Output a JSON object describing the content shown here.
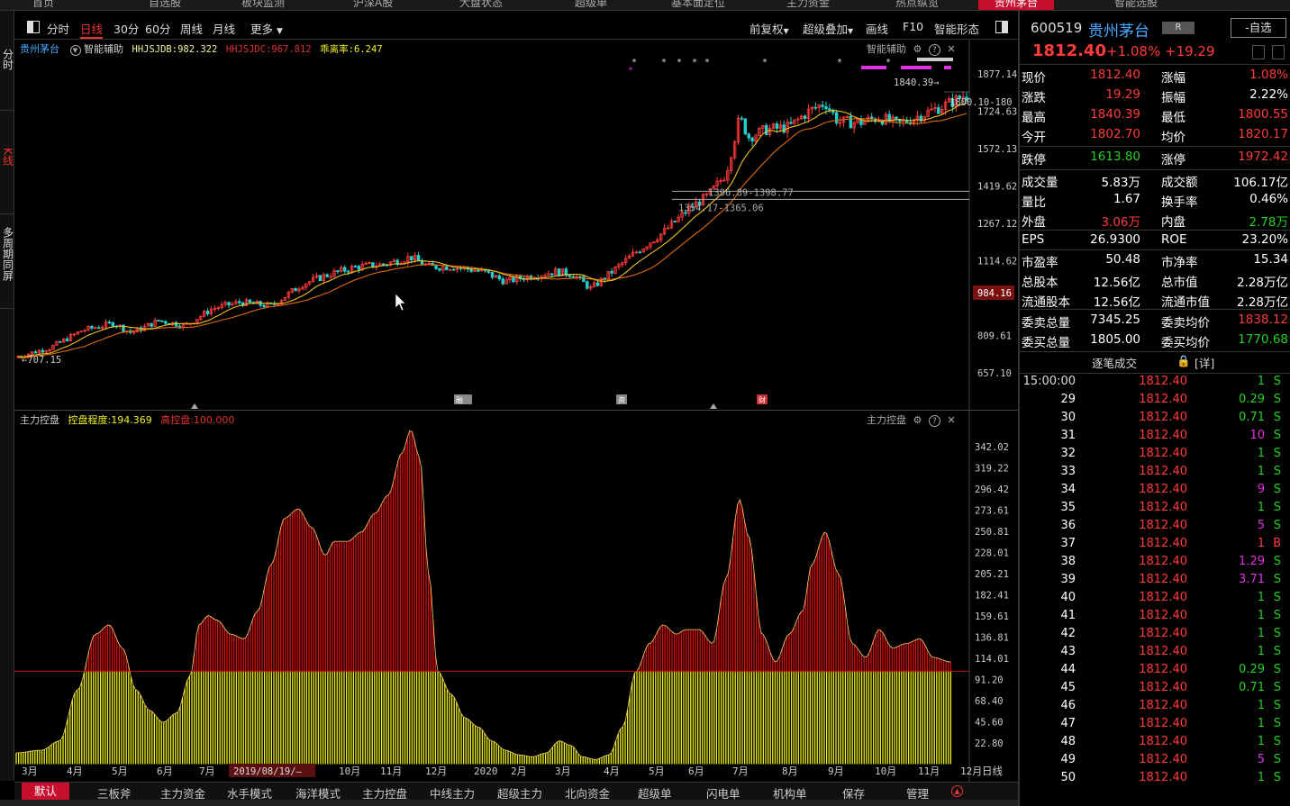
{
  "topnav": [
    {
      "label": "首页"
    },
    {
      "label": "自选股"
    },
    {
      "label": "板块监测"
    },
    {
      "label": "沪深A股"
    },
    {
      "label": "大盘状态"
    },
    {
      "label": "超级单"
    },
    {
      "label": "基本面定位"
    },
    {
      "label": "主力资金"
    },
    {
      "label": "热点纵览"
    },
    {
      "label": "贵州茅台"
    },
    {
      "label": "智能选股"
    }
  ],
  "leftbar": {
    "fenshi": "分时",
    "kxian": "K线",
    "multi": "多周期同屏"
  },
  "toolbar": {
    "left": [
      "分时",
      "日线",
      "30分",
      "60分",
      "周线",
      "月线",
      "更多"
    ],
    "right": [
      "前复权",
      "超级叠加",
      "画线",
      "F10",
      "智能形态"
    ]
  },
  "kchart": {
    "stock_name": "贵州茅台",
    "assist_label": "智能辅助",
    "ind1": "HHJSJDB:982.322",
    "ind2": "HHJSJDC:967.812",
    "ind3": "乖离率:6.247",
    "assist_right": "智能辅助",
    "y_ticks": [
      "1877.14",
      "1724.63",
      "1572.13",
      "1419.62",
      "1267.12",
      "1114.62",
      "984.16",
      "809.61",
      "657.10"
    ],
    "current_price_tag": "984.16",
    "annot_high": "1840.39",
    "annot_right": "1800.10-180",
    "annot_level1": "1396.89-1398.77",
    "annot_level2": "1354.17-1365.06",
    "annot_low": "707.15",
    "markers": [
      "融",
      "资",
      "财"
    ]
  },
  "indicator": {
    "name": "主力控盘",
    "v1": "控盘程度:194.369",
    "v2": "高控盘:100.000",
    "right_label": "主力控盘",
    "y_ticks": [
      "342.02",
      "319.22",
      "296.42",
      "273.61",
      "250.81",
      "228.01",
      "205.21",
      "182.41",
      "159.61",
      "136.81",
      "114.01",
      "91.20",
      "68.40",
      "45.60",
      "22.80"
    ],
    "x_ticks": [
      "3月",
      "4月",
      "5月",
      "6月",
      "7月",
      "2019/08/19/—",
      "10月",
      "11月",
      "12月",
      "2020",
      "2月",
      "3月",
      "4月",
      "5月",
      "6月",
      "7月",
      "8月",
      "9月",
      "10月",
      "11月",
      "12月"
    ],
    "period_label": "日线"
  },
  "bottomtabs": [
    "默认",
    "三板斧",
    "主力资金",
    "水手模式",
    "海洋模式",
    "主力控盘",
    "中线主力",
    "超级主力",
    "北向资金",
    "超级单",
    "闪电单",
    "机构单",
    "保存",
    "管理"
  ],
  "quote": {
    "code": "600519",
    "name": "贵州茅台",
    "badge": "R",
    "add_watch": "-自选",
    "price": "1812.40",
    "change_pct": "+1.08%",
    "change": "+19.29",
    "rows": [
      {
        "l1": "现价",
        "v1": "1812.40",
        "c1": "red",
        "l2": "涨幅",
        "v2": "1.08%",
        "c2": "red"
      },
      {
        "l1": "涨跌",
        "v1": "19.29",
        "c1": "red",
        "l2": "振幅",
        "v2": "2.22%",
        "c2": "white"
      },
      {
        "l1": "最高",
        "v1": "1840.39",
        "c1": "red",
        "l2": "最低",
        "v2": "1800.55",
        "c2": "red"
      },
      {
        "l1": "今开",
        "v1": "1802.70",
        "c1": "red",
        "l2": "均价",
        "v2": "1820.17",
        "c2": "red"
      },
      {
        "l1": "跌停",
        "v1": "1613.80",
        "c1": "green",
        "l2": "涨停",
        "v2": "1972.42",
        "c2": "red"
      },
      {
        "l1": "成交量",
        "v1": "5.83万",
        "c1": "white",
        "l2": "成交额",
        "v2": "106.17亿",
        "c2": "white"
      },
      {
        "l1": "量比",
        "v1": "1.67",
        "c1": "white",
        "l2": "换手率",
        "v2": "0.46%",
        "c2": "white"
      },
      {
        "l1": "外盘",
        "v1": "3.06万",
        "c1": "red",
        "l2": "内盘",
        "v2": "2.78万",
        "c2": "green"
      },
      {
        "l1": "EPS",
        "v1": "26.9300",
        "c1": "white",
        "l2": "ROE",
        "v2": "23.20%",
        "c2": "white"
      },
      {
        "l1": "市盈率",
        "v1": "50.48",
        "c1": "white",
        "l2": "市净率",
        "v2": "15.34",
        "c2": "white"
      },
      {
        "l1": "总股本",
        "v1": "12.56亿",
        "c1": "white",
        "l2": "总市值",
        "v2": "2.28万亿",
        "c2": "white"
      },
      {
        "l1": "流通股本",
        "v1": "12.56亿",
        "c1": "white",
        "l2": "流通市值",
        "v2": "2.28万亿",
        "c2": "white"
      },
      {
        "l1": "委卖总量",
        "v1": "7345.25",
        "c1": "white",
        "l2": "委卖均价",
        "v2": "1838.12",
        "c2": "red"
      },
      {
        "l1": "委买总量",
        "v1": "1805.00",
        "c1": "white",
        "l2": "委买均价",
        "v2": "1770.68",
        "c2": "green"
      }
    ],
    "ticks_title": "逐笔成交",
    "ticks_detail": "[详]",
    "ticks": [
      {
        "t": "15:00:00",
        "p": "1812.40",
        "v": "1",
        "c": "green",
        "s": "S"
      },
      {
        "t": "29",
        "p": "1812.40",
        "v": "0.29",
        "c": "green",
        "s": "S"
      },
      {
        "t": "30",
        "p": "1812.40",
        "v": "0.71",
        "c": "green",
        "s": "S"
      },
      {
        "t": "31",
        "p": "1812.40",
        "v": "10",
        "c": "purple",
        "s": "S"
      },
      {
        "t": "32",
        "p": "1812.40",
        "v": "1",
        "c": "green",
        "s": "S"
      },
      {
        "t": "33",
        "p": "1812.40",
        "v": "1",
        "c": "green",
        "s": "S"
      },
      {
        "t": "34",
        "p": "1812.40",
        "v": "9",
        "c": "purple",
        "s": "S"
      },
      {
        "t": "35",
        "p": "1812.40",
        "v": "1",
        "c": "green",
        "s": "S"
      },
      {
        "t": "36",
        "p": "1812.40",
        "v": "5",
        "c": "purple",
        "s": "S"
      },
      {
        "t": "37",
        "p": "1812.40",
        "v": "1",
        "c": "red",
        "s": "B"
      },
      {
        "t": "38",
        "p": "1812.40",
        "v": "1.29",
        "c": "purple",
        "s": "S"
      },
      {
        "t": "39",
        "p": "1812.40",
        "v": "3.71",
        "c": "purple",
        "s": "S"
      },
      {
        "t": "40",
        "p": "1812.40",
        "v": "1",
        "c": "green",
        "s": "S"
      },
      {
        "t": "41",
        "p": "1812.40",
        "v": "1",
        "c": "green",
        "s": "S"
      },
      {
        "t": "42",
        "p": "1812.40",
        "v": "1",
        "c": "green",
        "s": "S"
      },
      {
        "t": "43",
        "p": "1812.40",
        "v": "1",
        "c": "green",
        "s": "S"
      },
      {
        "t": "44",
        "p": "1812.40",
        "v": "0.29",
        "c": "green",
        "s": "S"
      },
      {
        "t": "45",
        "p": "1812.40",
        "v": "0.71",
        "c": "green",
        "s": "S"
      },
      {
        "t": "46",
        "p": "1812.40",
        "v": "1",
        "c": "green",
        "s": "S"
      },
      {
        "t": "47",
        "p": "1812.40",
        "v": "1",
        "c": "green",
        "s": "S"
      },
      {
        "t": "48",
        "p": "1812.40",
        "v": "1",
        "c": "green",
        "s": "S"
      },
      {
        "t": "49",
        "p": "1812.40",
        "v": "5",
        "c": "purple",
        "s": "S"
      },
      {
        "t": "50",
        "p": "1812.40",
        "v": "1",
        "c": "green",
        "s": "S"
      }
    ]
  },
  "colors": {
    "up": "#ff3b3b",
    "down": "#22d0d0",
    "ma": "#f0c020",
    "ind_red": "#e01010",
    "ind_yellow": "#f0f020",
    "accent": "#c8102e"
  }
}
